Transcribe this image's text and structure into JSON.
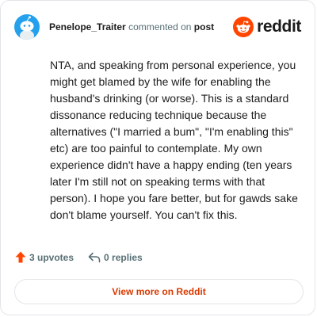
{
  "header": {
    "username": "Penelope_Traiter",
    "action_text": "commented on",
    "post_link": "post",
    "brand": "reddit"
  },
  "comment": {
    "body": "NTA, and speaking from personal experience, you might get blamed by the wife for enabling the husband's drinking (or worse). This is a standard dissonance reducing technique because the alternatives (\"I married a bum\", \"I'm enabling this\" etc) are too painful to contemplate. My own experience didn't have a happy ending (ten years later I'm still not on speaking terms with that person). I hope you fare better, but for gawds sake don't blame yourself. You can't fix this."
  },
  "stats": {
    "upvotes": "3 upvotes",
    "replies": "0 replies"
  },
  "footer": {
    "view_more_label": "View more on Reddit"
  },
  "colors": {
    "accent": "#d93900",
    "brand_orange": "#ff4500",
    "avatar_bg": "#24a0ed",
    "muted_text": "#576f76",
    "border": "#e3e5e8"
  },
  "icons": {
    "avatar": "snoo-avatar-icon",
    "brand": "reddit-logo-icon",
    "upvote": "upvote-arrow-icon",
    "reply": "reply-arrow-icon"
  }
}
